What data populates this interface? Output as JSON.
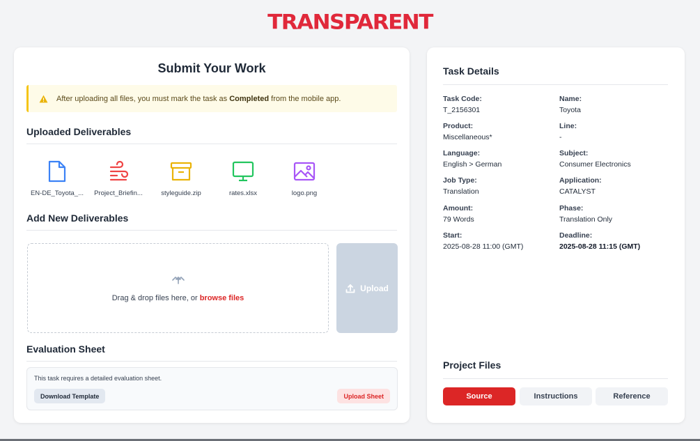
{
  "brand": {
    "logo_text": "TRANSPARENT",
    "accent": "#e0283a"
  },
  "submit": {
    "title": "Submit Your Work",
    "alert": {
      "prefix": "After uploading all files, you must mark the task as ",
      "emphasis": "Completed",
      "suffix": " from the mobile app.",
      "icon": "warning-icon"
    },
    "uploaded_heading": "Uploaded Deliverables",
    "files": [
      {
        "name": "EN-DE_Toyota_...",
        "icon": "document-icon",
        "color": "#3b82f6"
      },
      {
        "name": "Project_Briefin...",
        "icon": "file-wind-icon",
        "color": "#ef4444"
      },
      {
        "name": "styleguide.zip",
        "icon": "archive-icon",
        "color": "#eab308"
      },
      {
        "name": "rates.xlsx",
        "icon": "monitor-icon",
        "color": "#22c55e"
      },
      {
        "name": "logo.png",
        "icon": "image-icon",
        "color": "#a855f7"
      }
    ],
    "add_heading": "Add New Deliverables",
    "dropzone": {
      "text": "Drag & drop files here, or ",
      "browse_label": "browse files",
      "icon": "upload-cloud-icon"
    },
    "upload_button": {
      "label": "Upload",
      "icon": "upload-icon"
    },
    "evaluation": {
      "heading": "Evaluation Sheet",
      "text": "This task requires a detailed evaluation sheet.",
      "download_label": "Download Template",
      "upload_label": "Upload Sheet"
    }
  },
  "task": {
    "title": "Task Details",
    "fields": {
      "task_code": {
        "label": "Task Code:",
        "value": "T_2156301"
      },
      "name": {
        "label": "Name:",
        "value": "Toyota"
      },
      "product": {
        "label": "Product:",
        "value": "Miscellaneous*"
      },
      "line": {
        "label": "Line:",
        "value": "-"
      },
      "language": {
        "label": "Language:",
        "value": "English > German"
      },
      "subject": {
        "label": "Subject:",
        "value": "Consumer Electronics"
      },
      "job_type": {
        "label": "Job Type:",
        "value": "Translation"
      },
      "application": {
        "label": "Application:",
        "value": "CATALYST"
      },
      "amount": {
        "label": "Amount:",
        "value": "79 Words"
      },
      "phase": {
        "label": "Phase:",
        "value": "Translation Only"
      },
      "start": {
        "label": "Start:",
        "value": "2025-08-28 11:00 (GMT)"
      },
      "deadline": {
        "label": "Deadline:",
        "value": "2025-08-28 11:15 (GMT)"
      }
    },
    "project_files": {
      "heading": "Project Files",
      "tabs": [
        "Source",
        "Instructions",
        "Reference"
      ],
      "active_tab": "Source"
    }
  }
}
